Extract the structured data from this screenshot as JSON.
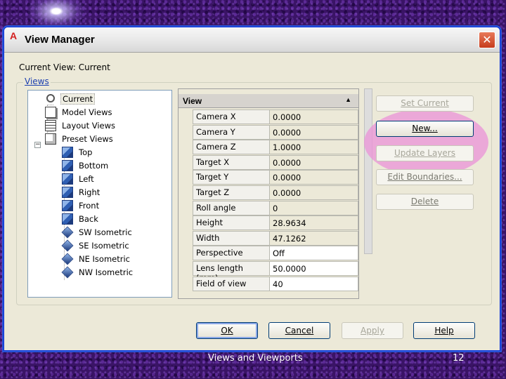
{
  "dialog": {
    "title": "View Manager",
    "app_icon": "A",
    "close_glyph": "✕",
    "current_view_label": "Current View:",
    "current_view_value": "Current",
    "views_group_label": "Views"
  },
  "tree": {
    "items": [
      {
        "label": "Current",
        "icon": "magnifier-icon",
        "selected": true
      },
      {
        "label": "Model Views",
        "icon": "model-views-icon"
      },
      {
        "label": "Layout Views",
        "icon": "layout-views-icon"
      },
      {
        "label": "Preset Views",
        "icon": "preset-views-icon",
        "expander": "−"
      },
      {
        "label": "Top",
        "icon": "cube-icon"
      },
      {
        "label": "Bottom",
        "icon": "cube-icon"
      },
      {
        "label": "Left",
        "icon": "cube-icon"
      },
      {
        "label": "Right",
        "icon": "cube-icon"
      },
      {
        "label": "Front",
        "icon": "cube-icon"
      },
      {
        "label": "Back",
        "icon": "cube-icon"
      },
      {
        "label": "SW Isometric",
        "icon": "isometric-icon"
      },
      {
        "label": "SE Isometric",
        "icon": "isometric-icon"
      },
      {
        "label": "NE Isometric",
        "icon": "isometric-icon"
      },
      {
        "label": "NW Isometric",
        "icon": "isometric-icon"
      }
    ]
  },
  "properties": {
    "header": "View",
    "collapse_glyph": "▲",
    "rows": [
      {
        "key": "Camera X",
        "value": "0.0000"
      },
      {
        "key": "Camera Y",
        "value": "0.0000"
      },
      {
        "key": "Camera Z",
        "value": "1.0000"
      },
      {
        "key": "Target X",
        "value": "0.0000"
      },
      {
        "key": "Target Y",
        "value": "0.0000"
      },
      {
        "key": "Target Z",
        "value": "0.0000"
      },
      {
        "key": "Roll angle",
        "value": "0"
      },
      {
        "key": "Height",
        "value": "28.9634"
      },
      {
        "key": "Width",
        "value": "47.1262"
      },
      {
        "key": "Perspective",
        "value": "Off"
      },
      {
        "key": "Lens length (mm)",
        "value": "50.0000"
      },
      {
        "key": "Field of view",
        "value": "40"
      }
    ]
  },
  "buttons": {
    "set_current": "Set Current",
    "new": "New...",
    "update_layers": "Update Layers",
    "edit_boundaries": "Edit Boundaries...",
    "delete": "Delete",
    "ok": "OK",
    "cancel": "Cancel",
    "apply": "Apply",
    "help": "Help"
  },
  "footer": {
    "caption": "Views and Viewports",
    "page_number": "12"
  }
}
